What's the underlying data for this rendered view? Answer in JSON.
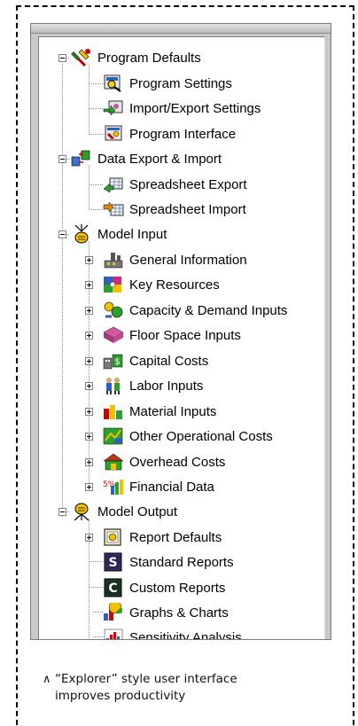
{
  "tree": {
    "program_defaults": {
      "label": "Program Defaults",
      "children": [
        "Program Settings",
        "Import/Export Settings",
        "Program Interface"
      ]
    },
    "data_export_import": {
      "label": "Data Export & Import",
      "children": [
        "Spreadsheet Export",
        "Spreadsheet Import"
      ]
    },
    "model_input": {
      "label": "Model Input",
      "children": [
        "General Information",
        "Key Resources",
        "Capacity & Demand Inputs",
        "Floor Space Inputs",
        "Capital Costs",
        "Labor Inputs",
        "Material Inputs",
        "Other Operational Costs",
        "Overhead Costs",
        "Financial Data"
      ]
    },
    "model_output": {
      "label": "Model Output",
      "children": [
        "Report Defaults",
        "Standard Reports",
        "Custom Reports",
        "Graphs & Charts",
        "Sensitivity Analysis"
      ]
    }
  },
  "report_icon_letters": {
    "standard": "S",
    "custom": "C"
  },
  "caption": {
    "mark": "∧",
    "line1": "“Explorer” style user interface",
    "line2": "improves productivity"
  },
  "colors": {
    "frame_gray": "#c8c8c8",
    "tree_line": "#8a8a8a",
    "report_icon_bg": "#3b2f6b"
  }
}
